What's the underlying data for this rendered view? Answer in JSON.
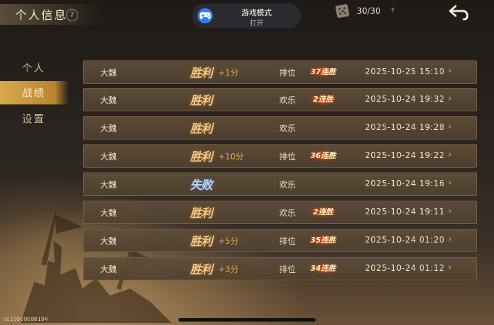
{
  "header": {
    "title": "个人信息",
    "help_glyph": "?",
    "game_mode": {
      "title": "游戏模式",
      "status": "打开"
    },
    "stamina": "30/30",
    "stamina_help_glyph": "?"
  },
  "tabs": [
    {
      "label": "个人",
      "active": false
    },
    {
      "label": "战绩",
      "active": true
    },
    {
      "label": "设置",
      "active": false
    }
  ],
  "records": [
    {
      "faction": "大魏",
      "result": "胜利",
      "win": true,
      "score": "+1分",
      "mode": "排位",
      "streak": "37连胜",
      "time": "2025-10-25 15:10"
    },
    {
      "faction": "大魏",
      "result": "胜利",
      "win": true,
      "score": "",
      "mode": "欢乐",
      "streak": "2连胜",
      "time": "2025-10-24 19:32"
    },
    {
      "faction": "大魏",
      "result": "胜利",
      "win": true,
      "score": "",
      "mode": "欢乐",
      "streak": "",
      "time": "2025-10-24 19:28"
    },
    {
      "faction": "大魏",
      "result": "胜利",
      "win": true,
      "score": "+10分",
      "mode": "排位",
      "streak": "36连胜",
      "time": "2025-10-24 19:22"
    },
    {
      "faction": "大魏",
      "result": "失败",
      "win": false,
      "score": "",
      "mode": "欢乐",
      "streak": "",
      "time": "2025-10-24 19:16"
    },
    {
      "faction": "大魏",
      "result": "胜利",
      "win": true,
      "score": "",
      "mode": "欢乐",
      "streak": "2连胜",
      "time": "2025-10-24 19:11"
    },
    {
      "faction": "大魏",
      "result": "胜利",
      "win": true,
      "score": "+5分",
      "mode": "排位",
      "streak": "35连胜",
      "time": "2025-10-24 01:20"
    },
    {
      "faction": "大魏",
      "result": "胜利",
      "win": true,
      "score": "+3分",
      "mode": "排位",
      "streak": "34连胜",
      "time": "2025-10-24 01:12"
    }
  ],
  "row_arrow": "›",
  "footer": {
    "user_id": "id:10000088194"
  },
  "icons": {
    "gamepad": "gamepad-icon",
    "stamina": "dice-icon",
    "back": "back-arrow-icon"
  },
  "colors": {
    "accent": "#d9a94a",
    "win": "#f0c78a",
    "lose": "#bfd4f4",
    "score": "#e7a652",
    "game_mode_icon": "#2d7ff9"
  }
}
